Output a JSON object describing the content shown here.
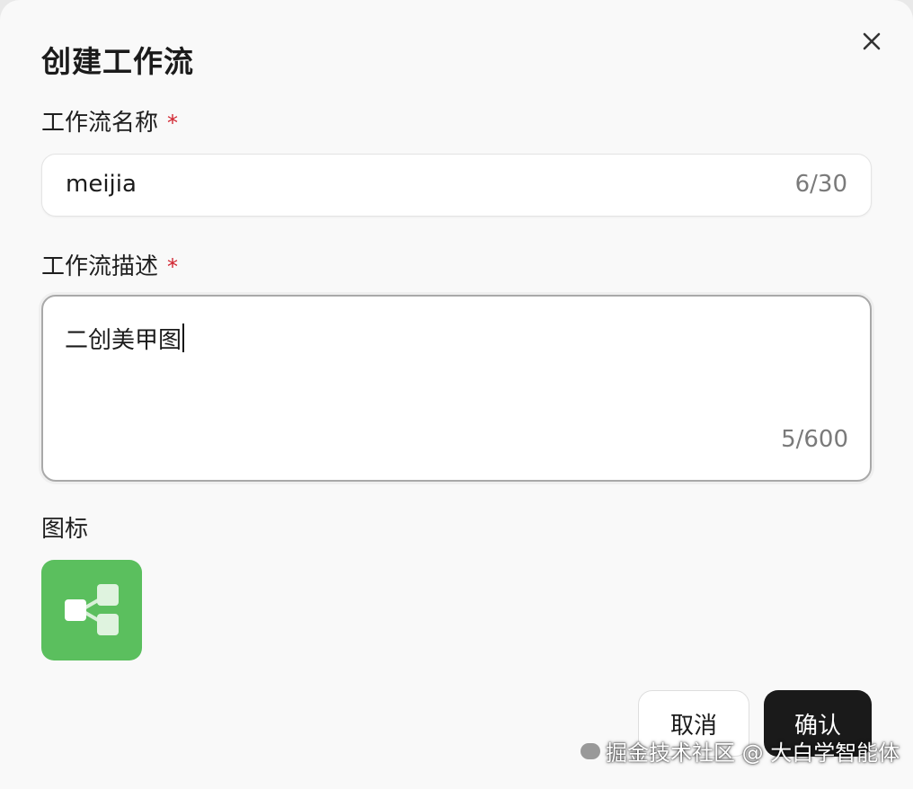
{
  "dialog": {
    "title": "创建工作流",
    "close_icon": "close-icon"
  },
  "name_field": {
    "label": "工作流名称",
    "required_mark": "*",
    "value": "meijia",
    "counter": "6/30"
  },
  "desc_field": {
    "label": "工作流描述",
    "required_mark": "*",
    "value": "二创美甲图",
    "counter": "5/600"
  },
  "icon_field": {
    "label": "图标",
    "icon": "workflow-icon",
    "color": "#5bbf5e"
  },
  "buttons": {
    "cancel": "取消",
    "confirm": "确认"
  },
  "watermark": {
    "text": "掘金技术社区 @ 大白学智能体"
  }
}
